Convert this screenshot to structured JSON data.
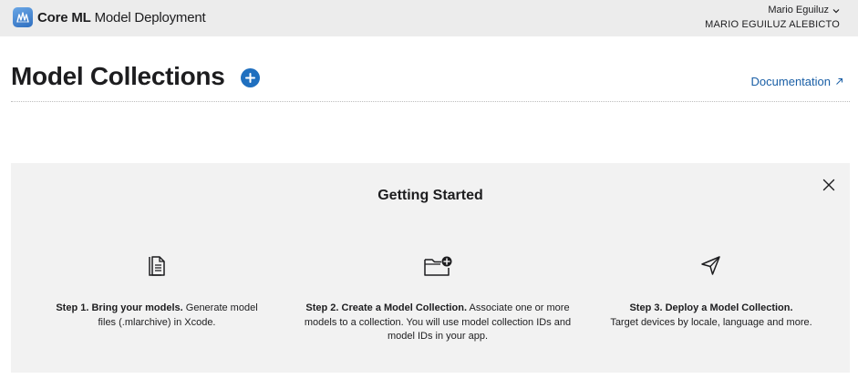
{
  "header": {
    "app_name_bold": "Core ML",
    "app_name_rest": "Model Deployment",
    "app_icon": "core-ml-icon",
    "user_name": "Mario Eguiluz",
    "user_org": "MARIO EGUILUZ ALEBICTO"
  },
  "page": {
    "title": "Model Collections",
    "add_icon": "plus-circle-icon",
    "documentation_link": "Documentation"
  },
  "getting_started": {
    "title": "Getting Started",
    "close_icon": "close-icon",
    "steps": [
      {
        "icon": "document-icon",
        "title": "Step 1. Bring your models.",
        "text": "Generate model files (.mlarchive) in Xcode."
      },
      {
        "icon": "folder-add-icon",
        "title": "Step 2. Create a Model Collection.",
        "text": "Associate one or more models to a collection. You will use model collection IDs and model IDs in your app."
      },
      {
        "icon": "paper-plane-icon",
        "title": "Step 3. Deploy a Model Collection.",
        "text": "Target devices by locale, language and more."
      }
    ]
  },
  "colors": {
    "accent": "#1f6fbf",
    "link": "#1a5fa6",
    "topbar_bg": "#ececec",
    "panel_bg": "#f2f2f2"
  }
}
